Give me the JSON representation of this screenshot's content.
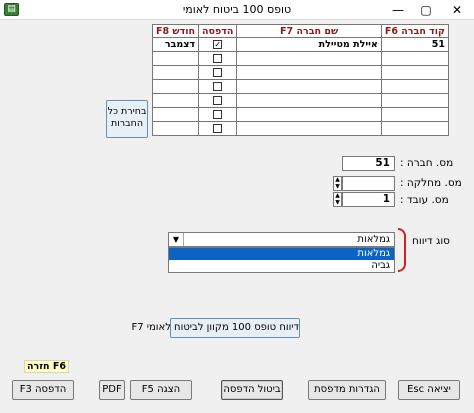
{
  "window": {
    "title": "טופס 100 ביטוח לאומי",
    "icon_name": "app-icon",
    "close_label": "✕",
    "max_label": "▢",
    "min_label": "—"
  },
  "table": {
    "headers": {
      "code": "קוד חברה F6",
      "name": "שם חברה F7",
      "print": "הדפסה",
      "month": "חודש F8"
    },
    "rows": [
      {
        "code": "51",
        "name": "איילת מטיילת",
        "print": true,
        "month": "דצמבר"
      },
      {
        "code": "",
        "name": "",
        "print": false,
        "month": ""
      },
      {
        "code": "",
        "name": "",
        "print": false,
        "month": ""
      },
      {
        "code": "",
        "name": "",
        "print": false,
        "month": ""
      },
      {
        "code": "",
        "name": "",
        "print": false,
        "month": ""
      },
      {
        "code": "",
        "name": "",
        "print": false,
        "month": ""
      },
      {
        "code": "",
        "name": "",
        "print": false,
        "month": ""
      }
    ]
  },
  "select_all_button": "בחירת כל החברות",
  "fields": {
    "company_label": "מס. חברה :",
    "company_value": "51",
    "department_label": "מס. מחלקה :",
    "department_value": "",
    "employee_label": "מס. עובד :",
    "employee_value": "1"
  },
  "report_type": {
    "label": "סוג דיווח",
    "selected": "גמלאות",
    "options": [
      "גמלאות",
      "גביה"
    ]
  },
  "report_button": "דיווח טופס 100 מקוון לביטוח לאומי F7",
  "f6_label": "F6 חזרה",
  "buttons": {
    "print": "הדפסה F3",
    "pdf": "PDF",
    "show": "הצגה F5",
    "cancel_print": "ביטול הדפסה",
    "printer_settings": "הגדרות מדפסת",
    "exit": "יציאה Esc"
  }
}
